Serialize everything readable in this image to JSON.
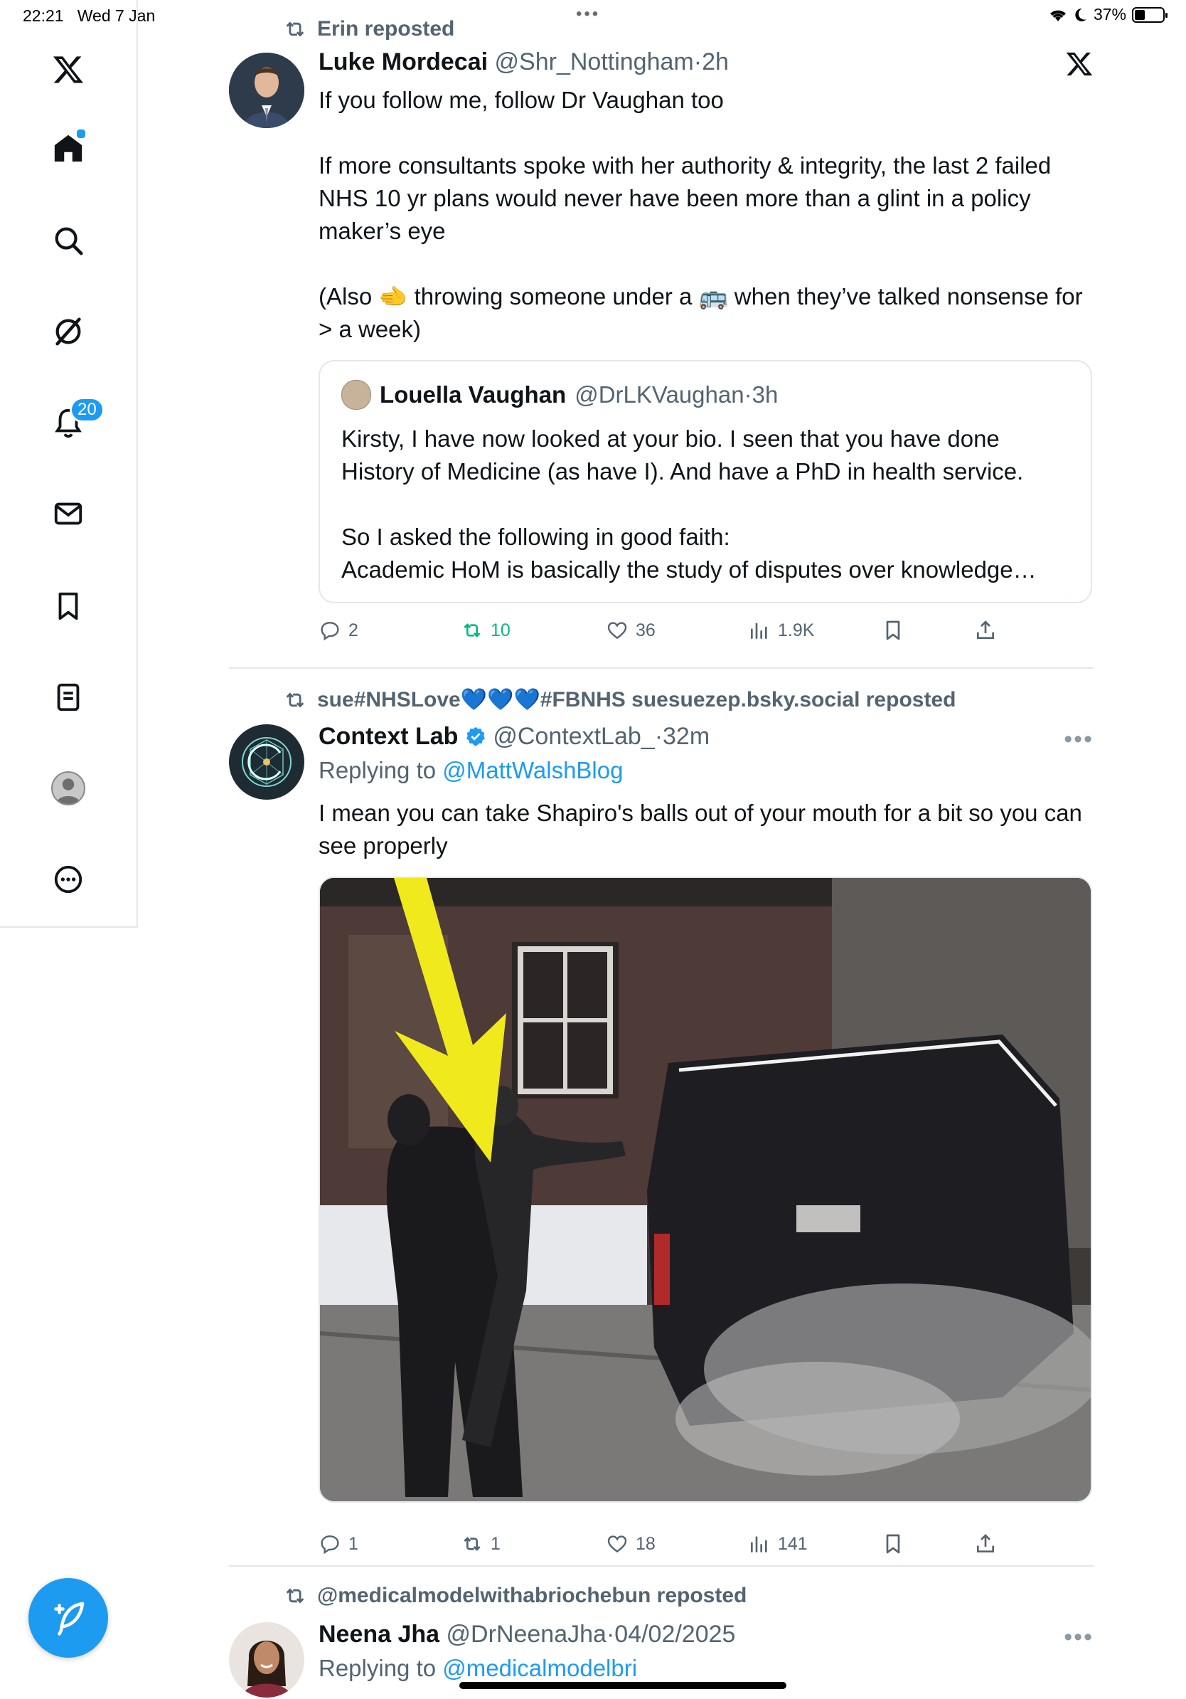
{
  "status_bar": {
    "time": "22:21",
    "date": "Wed 7 Jan",
    "battery": "37%",
    "battery_level": 0.37
  },
  "sidebar": {
    "notifications_count": "20"
  },
  "colors": {
    "accent": "#1d9bf0",
    "repost_green": "#00ba7c",
    "muted": "#536471"
  },
  "tweets": [
    {
      "repost_by": "Erin reposted",
      "name": "Luke Mordecai",
      "handle": "@Shr_Nottingham",
      "sep": "·",
      "time": "2h",
      "paragraphs": [
        "If you follow me, follow Dr Vaughan too",
        "If more consultants spoke with her authority & integrity, the last 2 failed NHS 10 yr plans would never have been more than a glint in a policy maker’s eye",
        "(Also 🫲 throwing someone under a 🚌 when they’ve talked nonsense for > a week)"
      ],
      "quote": {
        "name": "Louella Vaughan",
        "handle": "@DrLKVaughan",
        "sep": "·",
        "time": "3h",
        "paragraphs": [
          "Kirsty, I have now looked at your bio. I seen that you have done History of Medicine (as have I). And have a PhD in health service.",
          "So I asked the following in good faith:",
          "Academic HoM is basically the study of disputes over knowledge…"
        ]
      },
      "replies": "2",
      "reposts": "10",
      "likes": "36",
      "views": "1.9K"
    },
    {
      "repost_by": "sue#NHSLove💙💙💙#FBNHS suesuezep.bsky.social reposted",
      "name": "Context Lab",
      "handle": "@ContextLab_",
      "sep": "·",
      "time": "32m",
      "replying_label": "Replying to",
      "replying_to": "@MattWalshBlog",
      "text": "I mean you can take Shapiro's balls out of your mouth for a bit so you can see properly",
      "replies": "1",
      "reposts": "1",
      "likes": "18",
      "views": "141"
    },
    {
      "repost_by": "@medicalmodelwithabriochebun reposted",
      "name": "Neena Jha",
      "handle": "@DrNeenaJha",
      "sep": "·",
      "time": "04/02/2025",
      "replying_label": "Replying to",
      "replying_to": "@medicalmodelbri"
    }
  ]
}
